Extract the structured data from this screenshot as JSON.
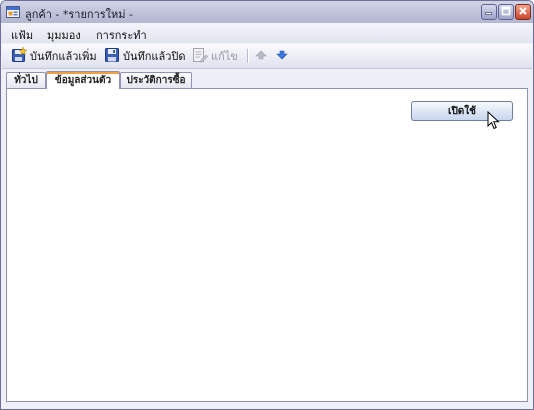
{
  "window": {
    "title": "ลูกค้า - *รายการใหม่ -",
    "icons": {
      "app": "form-icon",
      "minimize": "minimize-icon",
      "maximize": "maximize-icon",
      "close": "close-icon"
    }
  },
  "menu": {
    "items": [
      {
        "label": "แฟ้ม"
      },
      {
        "label": "มุมมอง"
      },
      {
        "label": "การกระทำ"
      }
    ]
  },
  "toolbar": {
    "save_and_new": {
      "label": "บันทึกแล้วเพิ่ม",
      "icon": "save-new-icon"
    },
    "save_and_close": {
      "label": "บันทึกแล้วปิด",
      "icon": "save-close-icon"
    },
    "edit": {
      "label": "แก้ไข",
      "icon": "edit-icon",
      "enabled": false
    },
    "prev": {
      "icon": "arrow-up-icon",
      "enabled": false
    },
    "next": {
      "icon": "arrow-down-icon",
      "enabled": true
    }
  },
  "tabs": [
    {
      "label": "ทั่วไป",
      "active": false
    },
    {
      "label": "ข้อมูลส่วนตัว",
      "active": true
    },
    {
      "label": "ประวัติการซื้อ",
      "active": false
    }
  ],
  "panel": {
    "enable_button": {
      "label": "เปิดใช้"
    }
  },
  "colors": {
    "title_bar": "#c3c5dc",
    "window_bg": "#eff0f7",
    "active_tab_accent": "#f0a040",
    "close_button": "#c9452a"
  }
}
